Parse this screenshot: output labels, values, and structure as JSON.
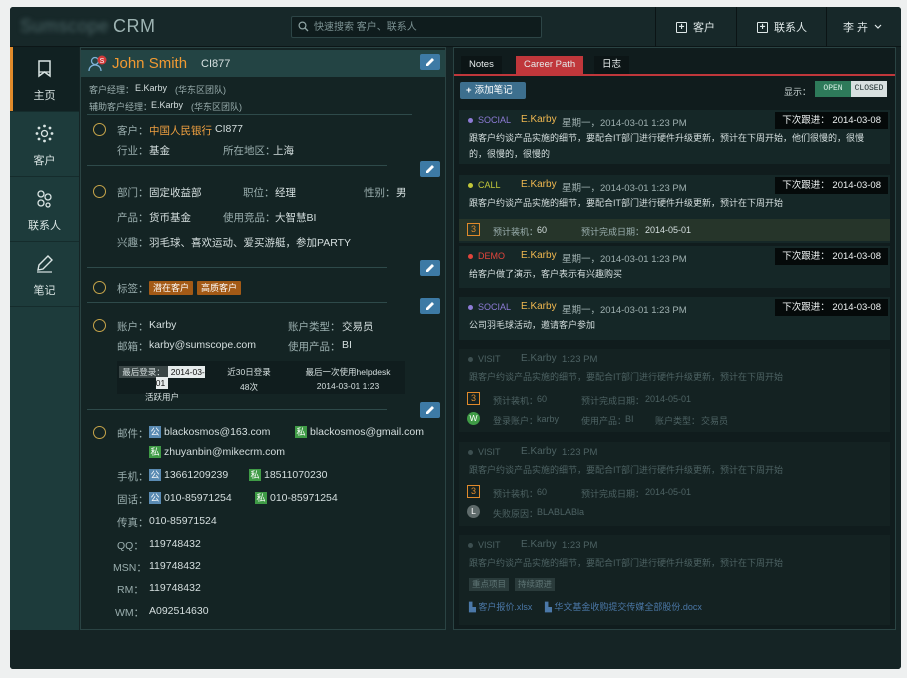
{
  "brand": {
    "logo_blurred": "Sumscope",
    "name": "CRM"
  },
  "search": {
    "placeholder": "快速搜索 客户、联系人"
  },
  "topbar": {
    "customer_btn": "客户",
    "contact_btn": "联系人",
    "user": "李 卉"
  },
  "sidebar": {
    "items": [
      {
        "label": "主页",
        "icon": "bookmark-icon"
      },
      {
        "label": "客户",
        "icon": "network-icon"
      },
      {
        "label": "联系人",
        "icon": "people-icon"
      },
      {
        "label": "笔记",
        "icon": "pen-icon"
      }
    ]
  },
  "contact": {
    "name": "John Smith",
    "code": "CI877",
    "manager_label": "客户经理：",
    "manager": "E.Karby",
    "manager_team": "(华东区团队)",
    "assist_label": "辅助客户经理：",
    "assist": "E.Karby",
    "assist_team": "(华东区团队)",
    "customer_label": "客户：",
    "customer": "中国人民银行",
    "customer_code": "CI877",
    "industry_label": "行业：",
    "industry": "基金",
    "region_label": "所在地区：",
    "region": "上海",
    "dept_label": "部门：",
    "dept": "固定收益部",
    "title_label": "职位：",
    "title": "经理",
    "gender_label": "性别：",
    "gender": "男",
    "product_label": "产品：",
    "product": "货币基金",
    "competitor_label": "使用竞品：",
    "competitor": "大智慧BI",
    "hobby_label": "兴趣：",
    "hobby": "羽毛球、喜欢运动、爱买游艇，参加PARTY",
    "tags_label": "标签：",
    "tags": [
      "潜在客户",
      "高质客户"
    ],
    "account_label": "账户：",
    "account": "Karby",
    "account_type_label": "账户类型：",
    "account_type": "交易员",
    "email_label": "邮箱：",
    "email": "karby@sumscope.com",
    "used_product_label": "使用产品：",
    "used_product": "BI",
    "stats": {
      "last_login_label": "最后登录：",
      "last_login": "2014-03-01",
      "active": "活跃用户",
      "logins_label": "近30日登录",
      "logins": "48次",
      "helpdesk_label": "最后一次使用helpdesk",
      "helpdesk": "2014-03-01  1:23"
    },
    "mail_label": "邮件：",
    "mail_pub": "blackosmos@163.com",
    "mail_pri": "blackosmos@gmail.com",
    "mail_pri2": "zhuyanbin@mikecrm.com",
    "mobile_label": "手机：",
    "mobile_pub": "13661209239",
    "mobile_pri": "18511070230",
    "phone_label": "固话：",
    "phone_pub": "010-85971254",
    "phone_pri": "010-85971254",
    "fax_label": "传真：",
    "fax": "010-85971524",
    "qq_label": "QQ：",
    "qq": "119748432",
    "msn_label": "MSN：",
    "msn": "119748432",
    "rm_label": "RM：",
    "rm": "119748432",
    "wm_label": "WM：",
    "wm": "A092514630",
    "badge_pub": "公",
    "badge_pri": "私",
    "avatar_badge": "S"
  },
  "notes": {
    "tabs": [
      "Notes",
      "Career Path",
      "日志"
    ],
    "add_note": "添加笔记",
    "show_label": "显示：",
    "open": "OPEN",
    "closed": "CLOSED",
    "entries": [
      {
        "type": "SOCIAL",
        "user": "E.Karby",
        "time": "星期一，2014-03-01 1:23 PM",
        "next": "下次跟进： 2014-03-08",
        "text": "跟客户约谈产品实施的细节，要配合IT部门进行硬件升级更新，预计在下周开始，他们很慢的，很慢的，很慢的，很慢的"
      },
      {
        "type": "CALL",
        "user": "E.Karby",
        "time": "星期一，2014-03-01 1:23 PM",
        "next": "下次跟进： 2014-03-08",
        "text": "跟客户约谈产品实施的细节，要配合IT部门进行硬件升级更新，预计在下周开始",
        "num": "3",
        "install_label": "预计装机：",
        "install": "60",
        "finish_label": "预计完成日期：",
        "finish": "2014-05-01"
      },
      {
        "type": "DEMO",
        "user": "E.Karby",
        "time": "星期一，2014-03-01 1:23 PM",
        "next": "下次跟进： 2014-03-08",
        "text": "给客户做了演示，客户表示有兴趣购买"
      },
      {
        "type": "SOCIAL",
        "user": "E.Karby",
        "time": "星期一，2014-03-01 1:23 PM",
        "next": "下次跟进： 2014-03-08",
        "text": "公司羽毛球活动，邀请客户参加"
      },
      {
        "type": "VISIT",
        "user": "E.Karby",
        "time": "1:23 PM",
        "text": "跟客户约谈产品实施的细节，要配合IT部门进行硬件升级更新，预计在下周开始",
        "num": "3",
        "install_label": "预计装机：",
        "install": "60",
        "finish_label": "预计完成日期：",
        "finish": "2014-05-01",
        "circle": "W",
        "acct_label": "登录账户：",
        "acct": "karby",
        "prod_label": "使用产品：",
        "prod": "BI",
        "acct_type_label": "账户类型：",
        "acct_type": "交易员"
      },
      {
        "type": "VISIT",
        "user": "E.Karby",
        "time": "1:23 PM",
        "text": "跟客户约谈产品实施的细节，要配合IT部门进行硬件升级更新，预计在下周开始",
        "num": "3",
        "install_label": "预计装机：",
        "install": "60",
        "finish_label": "预计完成日期：",
        "finish": "2014-05-01",
        "circle": "L",
        "lose_label": "失败原因：",
        "lose": "BLABLABla"
      },
      {
        "type": "VISIT",
        "user": "E.Karby",
        "time": "1:23 PM",
        "text": "跟客户约谈产品实施的细节，要配合IT部门进行硬件升级更新，预计在下周开始",
        "tags": [
          "重点项目",
          "持续跟进"
        ],
        "files": [
          "客户报价.xlsx",
          "华文基金收购提交传媒全部股份.docx"
        ]
      }
    ]
  },
  "colors": {
    "accent": "#f19a32",
    "social": "#8d7bd6",
    "call": "#c2c73a",
    "demo": "#e2453c",
    "active_tab": "#c0373b",
    "toggle_open": "#2e7a5a"
  }
}
